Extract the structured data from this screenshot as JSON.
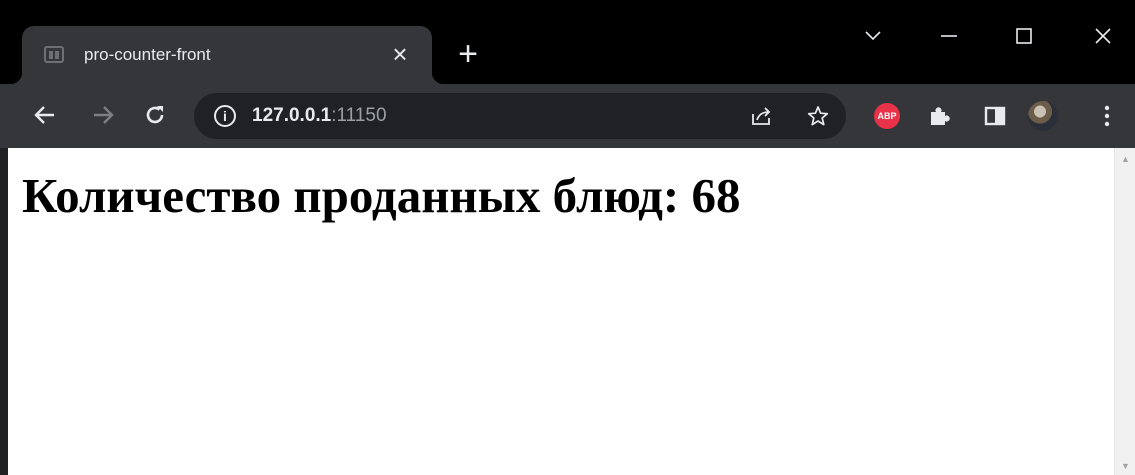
{
  "tab": {
    "title": "pro-counter-front",
    "close_symbol": "×"
  },
  "new_tab_symbol": "+",
  "omnibox": {
    "url_host": "127.0.0.1",
    "url_port": ":11150"
  },
  "extensions": {
    "abp_label": "ABP"
  },
  "page": {
    "heading": "Количество проданных блюд: 68"
  },
  "colors": {
    "titlebar": "#000000",
    "toolbar": "#35363a",
    "omnibox": "#202124",
    "abp": "#e8324a"
  }
}
